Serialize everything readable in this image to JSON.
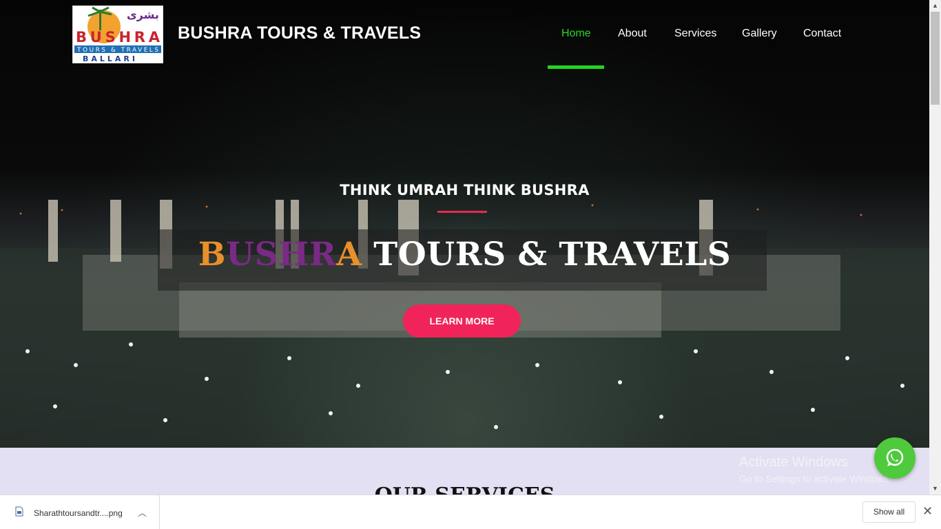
{
  "header": {
    "logo_text_top": "بشرى",
    "logo_text_mid": "BUSHRA",
    "logo_text_band": "TOURS & TRAVELS",
    "logo_text_bottom": "BALLARI",
    "brand": "BUSHRA TOURS & TRAVELS",
    "nav": [
      {
        "label": "Home",
        "active": true
      },
      {
        "label": "About",
        "active": false
      },
      {
        "label": "Services",
        "active": false
      },
      {
        "label": "Gallery",
        "active": false
      },
      {
        "label": "Contact",
        "active": false
      }
    ]
  },
  "hero": {
    "tagline": "THINK UMRAH THINK BUSHRA",
    "title_part1": "B",
    "title_part2": "USHR",
    "title_part3": "A",
    "title_rest": " TOURS & TRAVELS",
    "cta": "LEARN MORE"
  },
  "services": {
    "title": "OUR SERVICES"
  },
  "watermark": {
    "line1": "Activate Windows",
    "line2": "Go to Settings to activate Windows."
  },
  "download_bar": {
    "file_name": "Sharathtoursandtr....png",
    "show_all": "Show all"
  },
  "colors": {
    "nav_active": "#28d628",
    "accent_pink": "#f0245a",
    "title_orange": "#e8902a",
    "title_purple": "#7a2a85",
    "whatsapp_green": "#4fca3d"
  }
}
